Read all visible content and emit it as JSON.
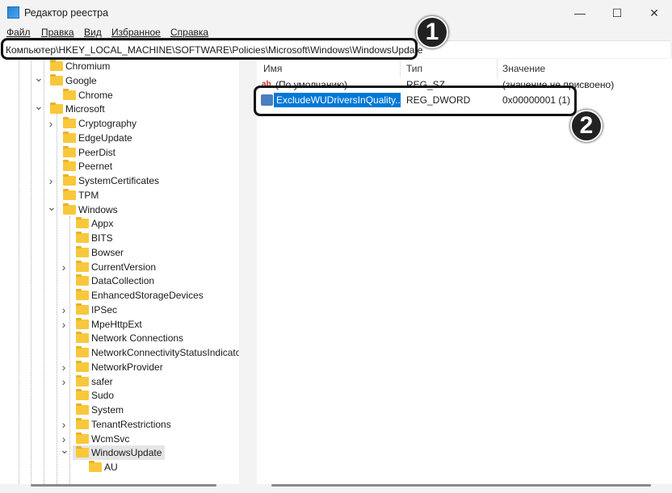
{
  "window": {
    "title": "Редактор реестра",
    "minimize": "—",
    "maximize": "☐",
    "close": "✕"
  },
  "menu": [
    "Файл",
    "Правка",
    "Вид",
    "Избранное",
    "Справка"
  ],
  "address": "Компьютер\\HKEY_LOCAL_MACHINE\\SOFTWARE\\Policies\\Microsoft\\Windows\\WindowsUpdate",
  "tree": [
    {
      "label": "Chromium",
      "level": 0,
      "arrow": ""
    },
    {
      "label": "Google",
      "level": 0,
      "arrow": "down"
    },
    {
      "label": "Chrome",
      "level": 1,
      "arrow": ""
    },
    {
      "label": "Microsoft",
      "level": 0,
      "arrow": "down"
    },
    {
      "label": "Cryptography",
      "level": 1,
      "arrow": "right"
    },
    {
      "label": "EdgeUpdate",
      "level": 1,
      "arrow": ""
    },
    {
      "label": "PeerDist",
      "level": 1,
      "arrow": ""
    },
    {
      "label": "Peernet",
      "level": 1,
      "arrow": ""
    },
    {
      "label": "SystemCertificates",
      "level": 1,
      "arrow": "right"
    },
    {
      "label": "TPM",
      "level": 1,
      "arrow": ""
    },
    {
      "label": "Windows",
      "level": 1,
      "arrow": "down"
    },
    {
      "label": "Appx",
      "level": 2,
      "arrow": ""
    },
    {
      "label": "BITS",
      "level": 2,
      "arrow": ""
    },
    {
      "label": "Bowser",
      "level": 2,
      "arrow": ""
    },
    {
      "label": "CurrentVersion",
      "level": 2,
      "arrow": "right"
    },
    {
      "label": "DataCollection",
      "level": 2,
      "arrow": ""
    },
    {
      "label": "EnhancedStorageDevices",
      "level": 2,
      "arrow": ""
    },
    {
      "label": "IPSec",
      "level": 2,
      "arrow": "right"
    },
    {
      "label": "MpeHttpExt",
      "level": 2,
      "arrow": "right"
    },
    {
      "label": "Network Connections",
      "level": 2,
      "arrow": ""
    },
    {
      "label": "NetworkConnectivityStatusIndicator",
      "level": 2,
      "arrow": ""
    },
    {
      "label": "NetworkProvider",
      "level": 2,
      "arrow": "right"
    },
    {
      "label": "safer",
      "level": 2,
      "arrow": "right"
    },
    {
      "label": "Sudo",
      "level": 2,
      "arrow": ""
    },
    {
      "label": "System",
      "level": 2,
      "arrow": ""
    },
    {
      "label": "TenantRestrictions",
      "level": 2,
      "arrow": "right"
    },
    {
      "label": "WcmSvc",
      "level": 2,
      "arrow": "right"
    },
    {
      "label": "WindowsUpdate",
      "level": 2,
      "arrow": "down",
      "selected": true
    },
    {
      "label": "AU",
      "level": 3,
      "arrow": ""
    }
  ],
  "columns": {
    "name": "Имя",
    "type": "Тип",
    "value": "Значение"
  },
  "values": [
    {
      "name": "(По умолчанию)",
      "type": "REG_SZ",
      "data": "(значение не присвоено)",
      "icon": "ab"
    },
    {
      "name": "ExcludeWUDriversInQuality...",
      "type": "REG_DWORD",
      "data": "0x00000001 (1)",
      "icon": "dword",
      "selected": true
    }
  ],
  "annotations": {
    "one": "1",
    "two": "2"
  },
  "colors": {
    "selection": "#0078d7",
    "folder": "#f8c83c"
  }
}
